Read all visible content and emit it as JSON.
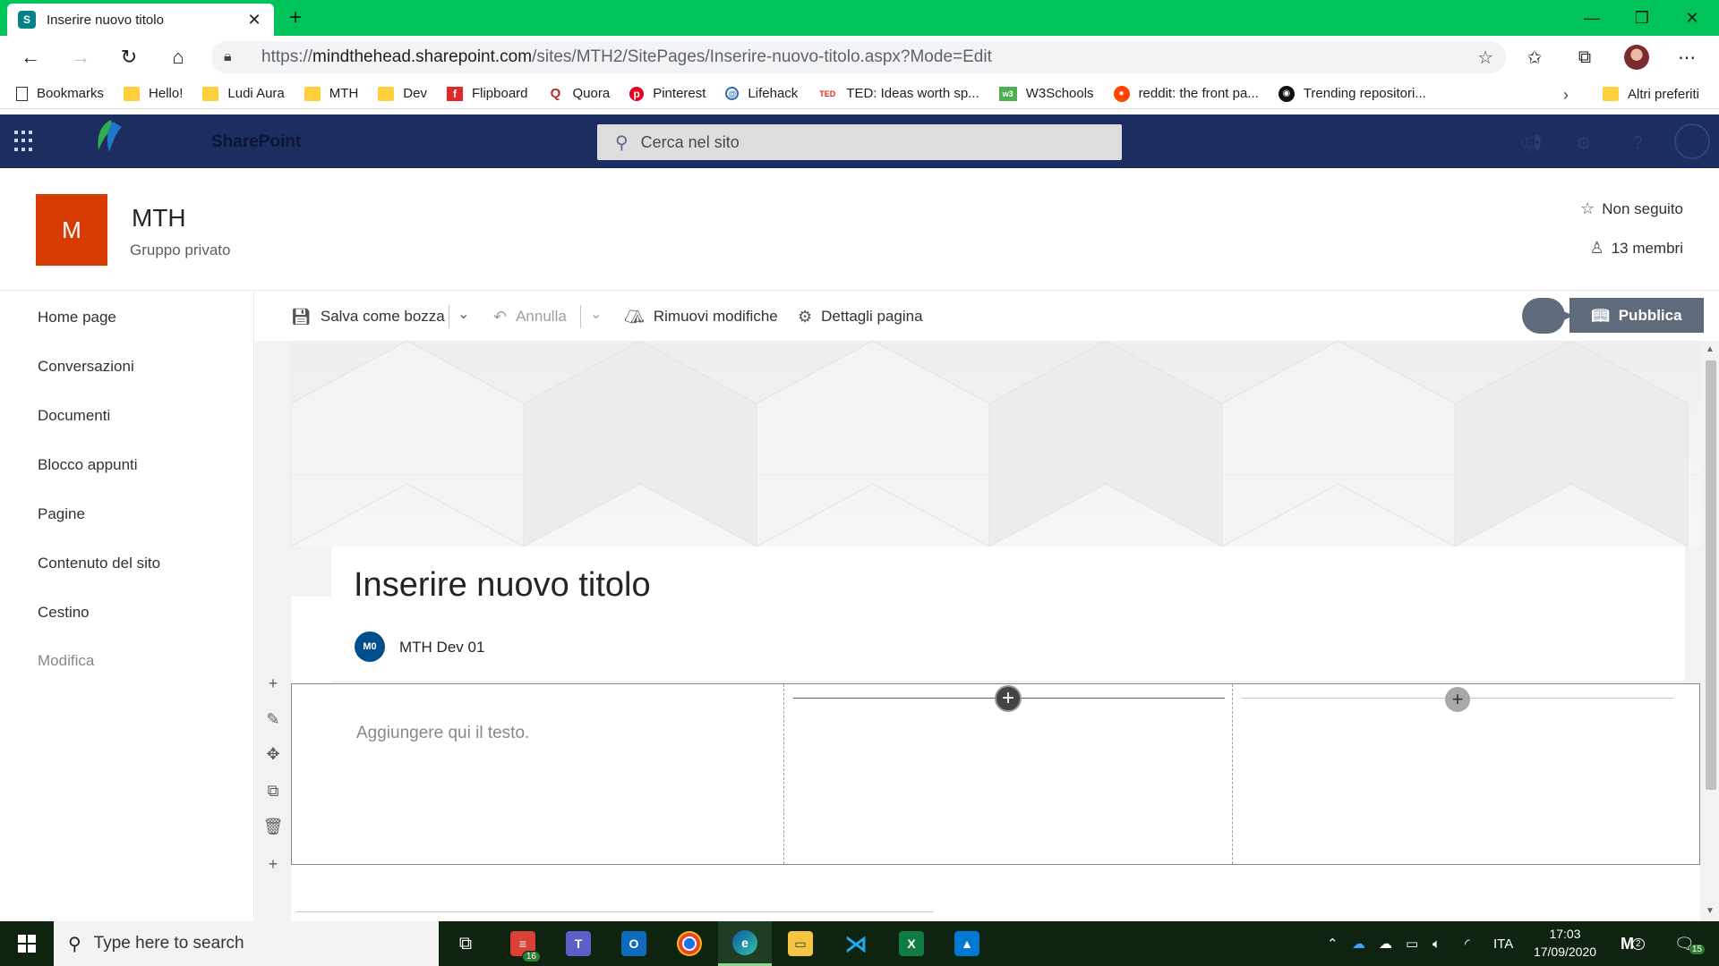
{
  "browser": {
    "tab_title": "Inserire nuovo titolo",
    "url_prefix": "https://",
    "url_host": "mindthehead.sharepoint.com",
    "url_path": "/sites/MTH2/SitePages/Inserire-nuovo-titolo.aspx?Mode=Edit",
    "bookmarks": [
      {
        "label": "Bookmarks",
        "icon": "page-icon"
      },
      {
        "label": "Hello!",
        "icon": "folder-icon"
      },
      {
        "label": "Ludi Aura",
        "icon": "folder-icon"
      },
      {
        "label": "MTH",
        "icon": "folder-icon"
      },
      {
        "label": "Dev",
        "icon": "folder-icon"
      },
      {
        "label": "Flipboard",
        "icon": "flipboard-icon"
      },
      {
        "label": "Quora",
        "icon": "quora-icon"
      },
      {
        "label": "Pinterest",
        "icon": "pinterest-icon"
      },
      {
        "label": "Lifehack",
        "icon": "lifehack-icon"
      },
      {
        "label": "TED: Ideas worth sp...",
        "icon": "ted-icon"
      },
      {
        "label": "W3Schools",
        "icon": "w3schools-icon"
      },
      {
        "label": "reddit: the front pa...",
        "icon": "reddit-icon"
      },
      {
        "label": "Trending repositori...",
        "icon": "github-icon"
      }
    ],
    "other_bookmarks": "Altri preferiti"
  },
  "suite": {
    "brand": "SharePoint",
    "search_placeholder": "Cerca nel sito"
  },
  "site": {
    "logo_letter": "M",
    "title": "MTH",
    "subtitle": "Gruppo privato",
    "follow": "Non seguito",
    "members": "13 membri"
  },
  "nav": {
    "items": [
      "Home page",
      "Conversazioni",
      "Documenti",
      "Blocco appunti",
      "Pagine",
      "Contenuto del sito",
      "Cestino"
    ],
    "edit": "Modifica"
  },
  "commands": {
    "save_draft": "Salva come bozza",
    "undo": "Annulla",
    "discard": "Rimuovi modifiche",
    "page_details": "Dettagli pagina",
    "publish": "Pubblica"
  },
  "page": {
    "title": "Inserire nuovo titolo",
    "author_initials": "M0",
    "author_name": "MTH Dev 01",
    "text_placeholder": "Aggiungere qui il testo."
  },
  "taskbar": {
    "search_placeholder": "Type here to search",
    "todo_badge": "16",
    "language": "ITA",
    "time": "17:03",
    "date": "17/09/2020",
    "notif_badge": "15",
    "m_badge": "2"
  },
  "colors": {
    "tab_bar": "#00c45a",
    "suite_bar": "#1c2d5f",
    "site_logo": "#d83b01",
    "publish": "#5f6b7a",
    "taskbar": "#0f2410"
  }
}
